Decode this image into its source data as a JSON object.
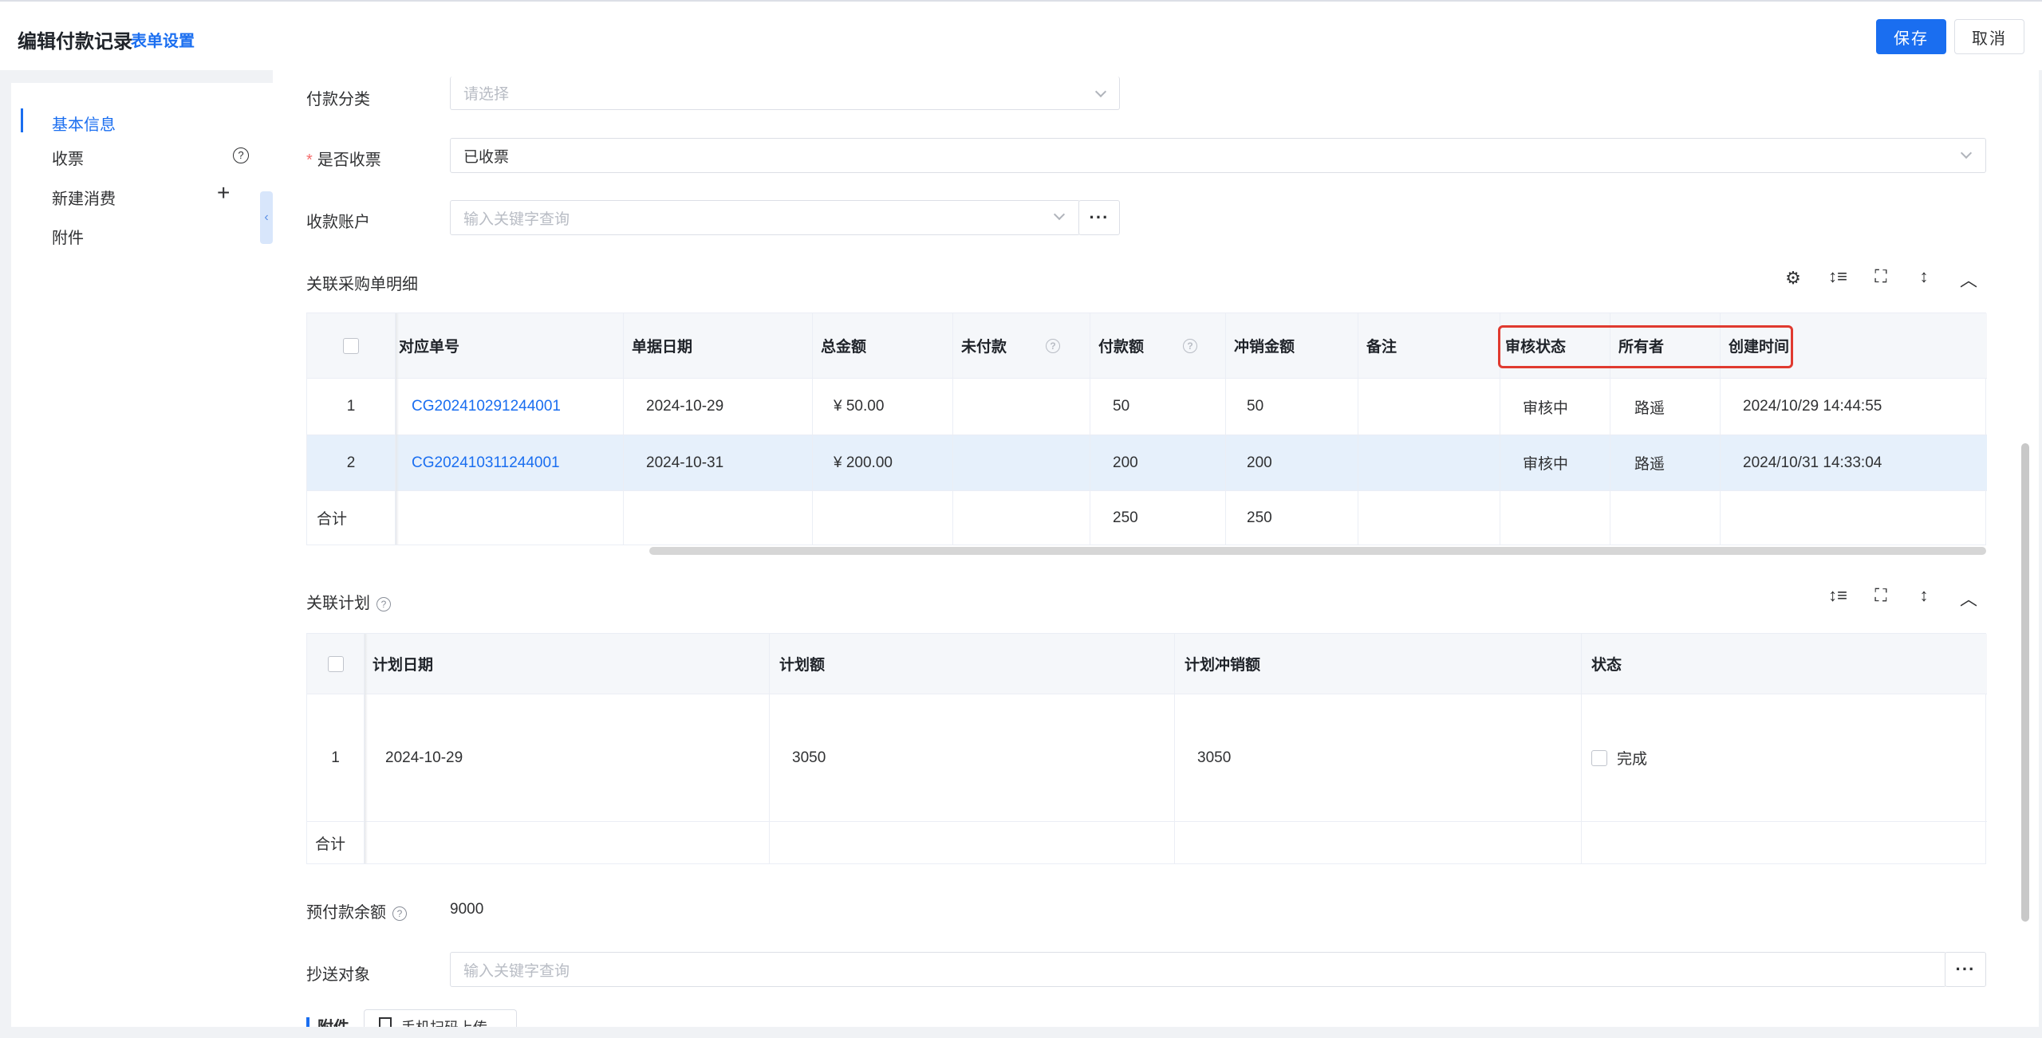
{
  "header": {
    "title": "编辑付款记录",
    "form_settings": "表单设置",
    "save_label": "保存",
    "cancel_label": "取消"
  },
  "nav": {
    "items": [
      "基本信息",
      "收票",
      "新建消费",
      "附件"
    ]
  },
  "form": {
    "payment_category": {
      "label": "付款分类",
      "placeholder": "请选择"
    },
    "invoice_received": {
      "label": "是否收票",
      "value": "已收票"
    },
    "receiving_account": {
      "label": "收款账户",
      "placeholder": "输入关键字查询"
    },
    "prepaid_balance": {
      "label": "预付款余额",
      "value": "9000"
    },
    "cc": {
      "label": "抄送对象",
      "placeholder": "输入关键字查询"
    },
    "attachments_label": "附件",
    "mobile_upload": "手机扫码上传"
  },
  "purchase_table": {
    "title": "关联采购单明细",
    "headers": [
      "对应单号",
      "单据日期",
      "总金额",
      "未付款",
      "付款额",
      "冲销金额",
      "备注",
      "审核状态",
      "所有者",
      "创建时间"
    ],
    "rows": [
      {
        "index": "1",
        "order_no": "CG202410291244001",
        "date": "2024-10-29",
        "total": "¥ 50.00",
        "unpaid": "",
        "payment": "50",
        "offset": "50",
        "remark": "",
        "status": "审核中",
        "owner": "路遥",
        "created": "2024/10/29 14:44:55"
      },
      {
        "index": "2",
        "order_no": "CG202410311244001",
        "date": "2024-10-31",
        "total": "¥ 200.00",
        "unpaid": "",
        "payment": "200",
        "offset": "200",
        "remark": "",
        "status": "审核中",
        "owner": "路遥",
        "created": "2024/10/31 14:33:04"
      }
    ],
    "total_row": {
      "label": "合计",
      "payment": "250",
      "offset": "250"
    }
  },
  "plan_table": {
    "title": "关联计划",
    "headers": [
      "计划日期",
      "计划额",
      "计划冲销额",
      "状态"
    ],
    "rows": [
      {
        "index": "1",
        "date": "2024-10-29",
        "amount": "3050",
        "offset": "3050",
        "status": "完成"
      }
    ],
    "total_row": {
      "label": "合计"
    }
  },
  "colors": {
    "accent": "#1a6ef0",
    "highlight_box": "#e03a2f",
    "row_highlight": "#e6f0fb"
  }
}
